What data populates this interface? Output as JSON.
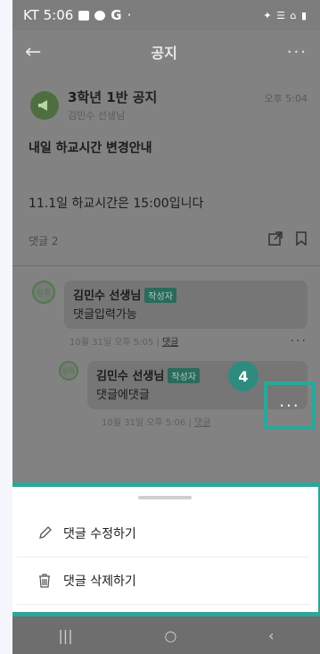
{
  "status": {
    "carrier_time": "KT 5:06",
    "right_icons": "✦ ☰ ⌂ ▮"
  },
  "appbar": {
    "back_icon": "←",
    "title": "공지",
    "more_icon": "···"
  },
  "post": {
    "avatar_icon": "megaphone-icon",
    "title": "3학년 1반 공지",
    "author": "김민수 선생님",
    "time": "오후 5:04",
    "notice_title": "내일 하교시간 변경안내",
    "body": "11.1일 하교시간은 15:00입니다",
    "comment_count": "댓글 2"
  },
  "comment1": {
    "avatar": "왕특",
    "name": "김민수 선생님",
    "badge": "작성자",
    "text": "댓글입력가능",
    "time": "10월 31일 오후 5:05",
    "reply": "댓글",
    "more": "···"
  },
  "comment2": {
    "avatar": "왕특",
    "name": "김민수 선생님",
    "badge": "작성자",
    "text": "댓글에댓글",
    "time": "10월 31일 오후 5:06",
    "reply": "댓글",
    "more": "···"
  },
  "callout": {
    "step": "4"
  },
  "sheet": {
    "edit_label": "댓글 수정하기",
    "delete_label": "댓글 삭제하기"
  },
  "nav": {
    "recent": "|||",
    "home": "○",
    "back": "‹"
  },
  "colors": {
    "accent": "#2ba79a",
    "badge": "#2c6a5c"
  }
}
